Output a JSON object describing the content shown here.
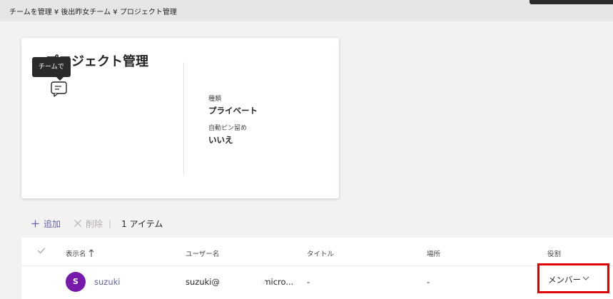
{
  "breadcrumb": "チームを管理 ¥ 後出昨女チーム ¥ プロジェクト管理",
  "card": {
    "title": "プロジェクト管理",
    "tooltip": "チームで",
    "chat_icon": "chat-icon",
    "properties": [
      {
        "label": "種類",
        "value": "プライベート"
      },
      {
        "label": "自動ピン留め",
        "value": "いいえ"
      }
    ]
  },
  "toolbar": {
    "add_icon": "plus-icon",
    "add_label": "追加",
    "delete_icon": "close-icon",
    "delete_label": "削除",
    "separator": "|",
    "item_count": "1 アイテム"
  },
  "table": {
    "columns": [
      {
        "label": "表示名",
        "sort": "ascending"
      },
      {
        "label": "ユーザー名"
      },
      {
        "label": "タイトル"
      },
      {
        "label": "場所"
      },
      {
        "label": "役割"
      }
    ],
    "rows": [
      {
        "avatar_initial": "S",
        "display_name": "suzuki",
        "username": "suzuki@",
        "username_tail": "onmicro...",
        "title": "-",
        "location": "-",
        "role": "メンバー"
      }
    ]
  },
  "colors": {
    "accent": "#6264a7",
    "avatar": "#7719aa",
    "highlight": "#e00000"
  }
}
